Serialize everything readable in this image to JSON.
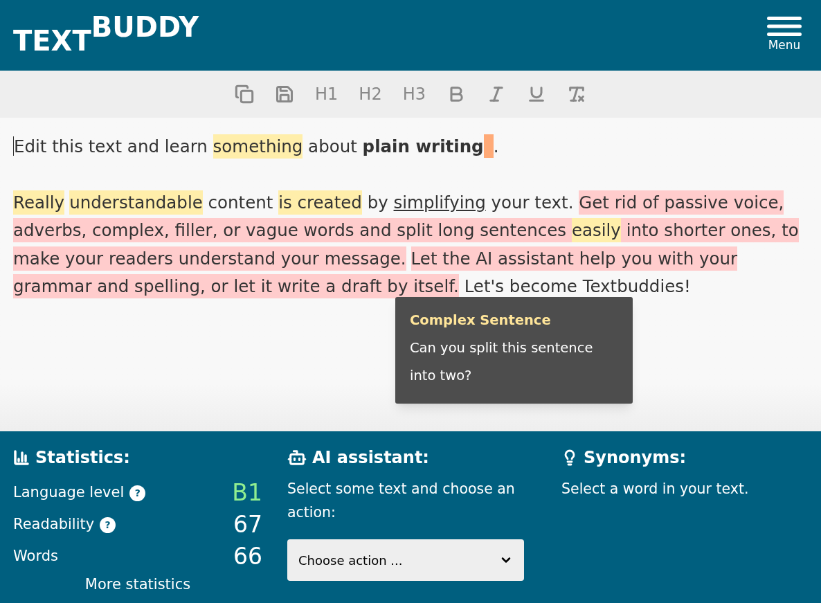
{
  "header": {
    "logo": {
      "part_1": "TEXT",
      "part_2": "BUDDY"
    },
    "menu_label": "Menu"
  },
  "toolbar": [
    {
      "kind": "copy"
    },
    {
      "kind": "save"
    },
    {
      "kind": "text",
      "label": "H1"
    },
    {
      "kind": "text",
      "label": "H2"
    },
    {
      "kind": "text",
      "label": "H3"
    },
    {
      "kind": "bold"
    },
    {
      "kind": "italic"
    },
    {
      "kind": "underline"
    },
    {
      "kind": "clear"
    }
  ],
  "editor": {
    "paragraphs": [
      [
        {
          "kind": "text",
          "text": "Edit this text and learn "
        },
        {
          "kind": "text",
          "text": "something",
          "color": "#ffeeaa"
        },
        {
          "kind": "text",
          "text": " about "
        },
        {
          "kind": "text",
          "text": "plain writing",
          "bold": true
        },
        {
          "kind": "marker",
          "color": "#ffaa77"
        },
        {
          "kind": "text",
          "text": "."
        }
      ],
      [
        {
          "kind": "text",
          "text": "Really",
          "color": "#ffeeaa"
        },
        {
          "kind": "text",
          "text": "understandable",
          "color": "#ffeeaa",
          "spaced": true
        },
        {
          "kind": "text",
          "text": " content "
        },
        {
          "kind": "text",
          "text": "is created",
          "color": "#ffeeaa"
        },
        {
          "kind": "text",
          "text": " by "
        },
        {
          "kind": "text",
          "text": "simplifying",
          "underline": true
        },
        {
          "kind": "text",
          "text": " your text. "
        },
        {
          "kind": "text",
          "text": "Get rid of passive voice, adverbs, complex, filler, or vague words and split long sentences ",
          "color": "#ffcccc"
        },
        {
          "kind": "text",
          "text": "easily",
          "color": "#ffeeaa"
        },
        {
          "kind": "text",
          "text": " into shorter ones, to make your readers understand your message.",
          "color": "#ffcccc"
        },
        {
          "kind": "text",
          "text": "Let the AI assistant help you with your grammar and spelling, or let it write a draft by itself.",
          "color": "#ffcccc",
          "spaced": true
        },
        {
          "kind": "text",
          "text": " Let's become Textbuddies!"
        }
      ]
    ],
    "tooltip": {
      "title": "Complex Sentence",
      "body": "Can you split this sentence into two?"
    }
  },
  "statistics": {
    "title": "Statistics:",
    "rows": [
      {
        "label": "Language level",
        "help_icon": "?",
        "value": "B1",
        "color": "#90ee90"
      },
      {
        "label": "Readability",
        "help_icon": "?",
        "value": "67",
        "color": "#ffffff"
      },
      {
        "label": "Words",
        "value": "66",
        "color": "#ffffff"
      }
    ],
    "more_link": "More statistics"
  },
  "ai_assistant": {
    "title": "AI assistant:",
    "hint": "Select some text and choose an action:",
    "select": {
      "value": "Choose action ..."
    }
  },
  "synonyms": {
    "title": "Synonyms:",
    "hint": "Select a word in your text."
  }
}
